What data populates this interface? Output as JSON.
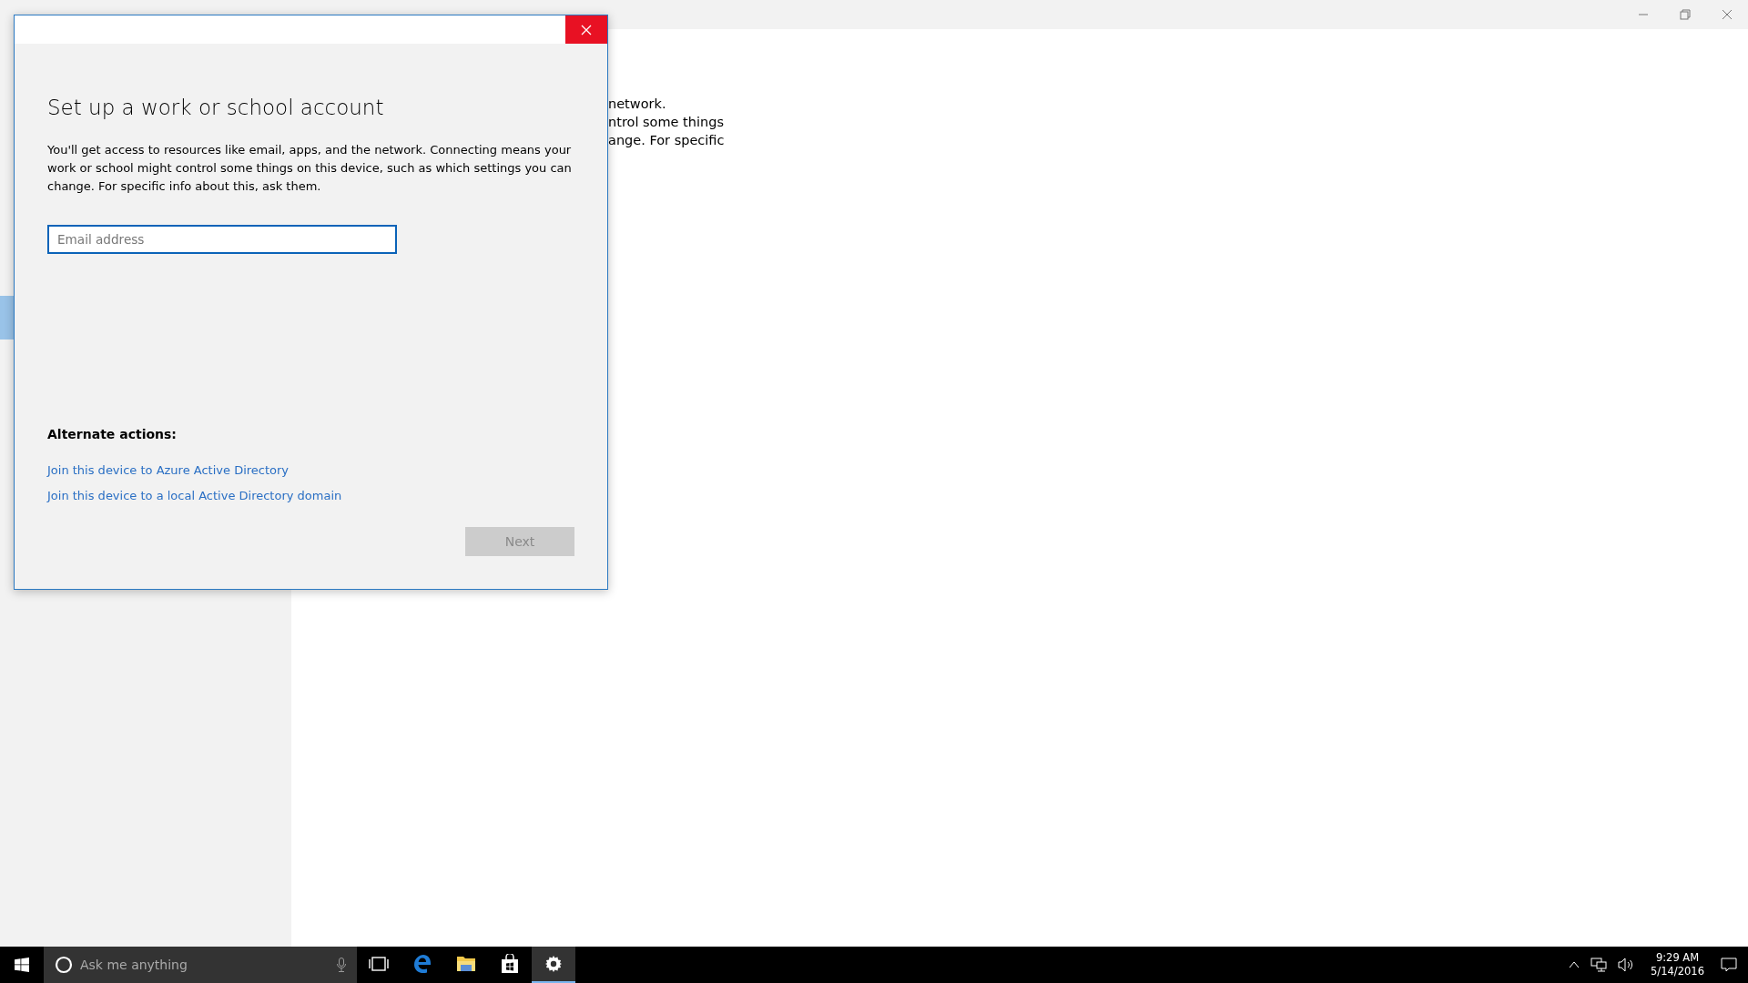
{
  "window": {
    "controls": [
      {
        "kind": "minimize"
      },
      {
        "kind": "restore"
      },
      {
        "kind": "close"
      }
    ]
  },
  "main": {
    "lines": [
      "network.",
      "ntrol some things",
      "ange. For specific"
    ]
  },
  "dialog": {
    "title": "Set up a work or school account",
    "description": "You'll get access to resources like email, apps, and the network. Connecting means your work or school might control some things on this device, such as which settings you can change. For specific info about this, ask them.",
    "email_field": {
      "placeholder": "Email address"
    },
    "alternate_heading": "Alternate actions:",
    "links": [
      "Join this device to Azure Active Directory",
      "Join this device to a local Active Directory domain"
    ],
    "next_button": {
      "label": "Next",
      "disabled": true
    }
  },
  "taskbar": {
    "search_placeholder": "Ask me anything",
    "apps": [
      {
        "kind": "taskview",
        "selected": false
      },
      {
        "kind": "edge",
        "selected": false
      },
      {
        "kind": "explorer",
        "selected": false
      },
      {
        "kind": "store",
        "selected": false
      },
      {
        "kind": "settings",
        "selected": true
      }
    ],
    "clock": {
      "time": "9:29 AM",
      "date": "5/14/2016"
    }
  }
}
